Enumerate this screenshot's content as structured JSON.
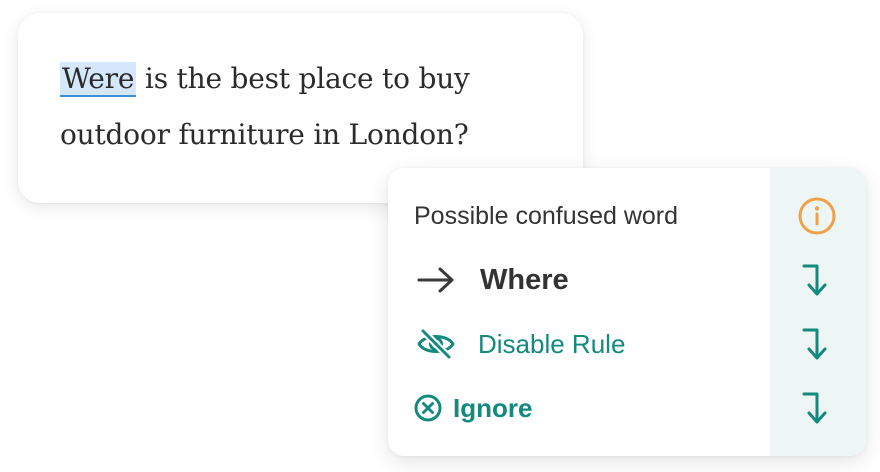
{
  "editor": {
    "flagged_word": "Were",
    "sentence_rest": " is the best place to buy outdoor furniture in London?"
  },
  "popup": {
    "title": "Possible confused word",
    "suggestion": "Where",
    "disable_rule_label": "Disable Rule",
    "ignore_label": "Ignore",
    "icons": {
      "info": "info-circle-icon",
      "arrow": "right-arrow-icon",
      "disable": "eye-slash-icon",
      "ignore": "close-circle-icon",
      "apply": "turn-down-arrow-icon"
    },
    "colors": {
      "accent": "#14897d",
      "warning": "#f0a04b",
      "highlight": "#d5e7fb",
      "underline": "#3a8fd8",
      "action_column_bg": "#eef6f5"
    }
  }
}
